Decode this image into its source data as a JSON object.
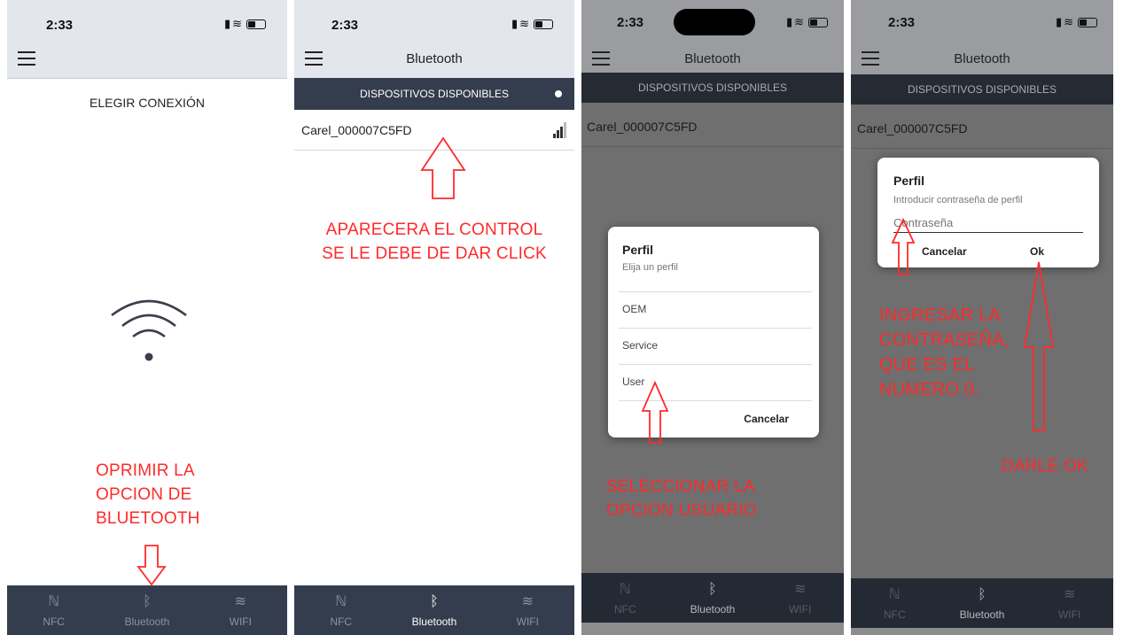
{
  "status": {
    "time": "2:33"
  },
  "tabs": {
    "nfc": "NFC",
    "bluetooth": "Bluetooth",
    "wifi": "WIFI"
  },
  "screen1": {
    "heading": "ELEGIR CONEXIÓN",
    "note_lines": [
      "OPRIMIR LA",
      "OPCION DE",
      "BLUETOOTH"
    ]
  },
  "screen2": {
    "title": "Bluetooth",
    "section": "DISPOSITIVOS DISPONIBLES",
    "device": "Carel_000007C5FD",
    "note_lines": [
      "APARECERA EL CONTROL",
      "SE LE DEBE DE DAR CLICK"
    ]
  },
  "screen3": {
    "title": "Bluetooth",
    "section": "DISPOSITIVOS DISPONIBLES",
    "device": "Carel_000007C5FD",
    "dialog": {
      "title": "Perfil",
      "subtitle": "Elija un perfil",
      "options": [
        "OEM",
        "Service",
        "User"
      ],
      "cancel": "Cancelar"
    },
    "note_lines": [
      "SELECCIONAR LA",
      "OPCION USUARIO"
    ]
  },
  "screen4": {
    "title": "Bluetooth",
    "section": "DISPOSITIVOS DISPONIBLES",
    "device": "Carel_000007C5FD",
    "dialog": {
      "title": "Perfil",
      "subtitle": "Introducir contraseña de perfil",
      "placeholder": "Contraseña",
      "cancel": "Cancelar",
      "ok": "Ok"
    },
    "note_lines": [
      "INGRESAR LA",
      "CONTRASEÑA,",
      "QUE ES EL",
      "NUMERO 0."
    ],
    "note2": "DARLE OK"
  },
  "colors": {
    "annotation": "#ff2a2a",
    "dark_bar": "#343d4d",
    "status_bg": "#e3e6ec"
  },
  "icons": {
    "nfc": "nfc-icon",
    "bluetooth": "bluetooth-icon",
    "wifi": "wifi-icon",
    "menu": "hamburger-icon",
    "signal": "signal-strength-icon",
    "arrow": "arrow-annotation"
  }
}
